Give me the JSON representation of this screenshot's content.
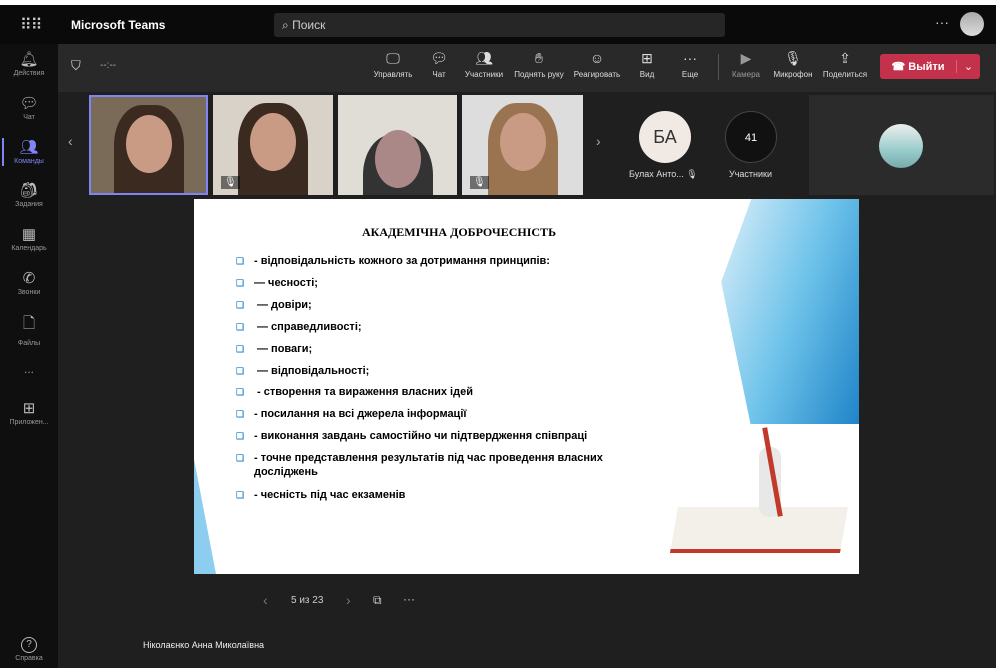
{
  "app": {
    "title": "Microsoft Teams",
    "search_placeholder": "Поиск"
  },
  "rail": [
    {
      "label": "Действия",
      "icon": "bell-icon"
    },
    {
      "label": "Чат",
      "icon": "chat-icon"
    },
    {
      "label": "Команды",
      "icon": "teams-icon"
    },
    {
      "label": "Задания",
      "icon": "backpack-icon"
    },
    {
      "label": "Календарь",
      "icon": "calendar-icon"
    },
    {
      "label": "Звонки",
      "icon": "phone-icon"
    },
    {
      "label": "Файлы",
      "icon": "file-icon"
    },
    {
      "label": "...",
      "icon": "more-icon"
    },
    {
      "label": "Приложен...",
      "icon": "apps-icon"
    }
  ],
  "help": "Справка",
  "meeting": {
    "timer": "--:--",
    "buttons": [
      "Управлять",
      "Чат",
      "Участники",
      "Поднять руку",
      "Реагировать",
      "Вид",
      "Еще",
      "Камера",
      "Микрофон",
      "Поделиться"
    ],
    "leave": "Выйти"
  },
  "participants": {
    "avatar_initials": "БА",
    "avatar_name": "Булах Анто...",
    "count": "41",
    "count_label": "Участники"
  },
  "slide": {
    "title": "АКАДЕМІЧНА ДОБРОЧЕСНІСТЬ",
    "bullets": [
      "- відповідальність кожного за дотримання принципів:",
      "— чесності;",
      "— довіри;",
      "— справедливості;",
      "— поваги;",
      "— відповідальності;",
      "- створення та вираження власних ідей",
      "- посилання на всі джерела інформації",
      "- виконання завдань самостійно чи підтвердження співпраці",
      "- точне представлення результатів під час проведення власних досліджень",
      "- чесність під час екзаменів"
    ]
  },
  "slide_nav": {
    "page": "5 из 23"
  },
  "presenter": "Ніколаєнко Анна Миколаївна",
  "colors": {
    "accent": "#7f85f5",
    "leave": "#c4314b"
  }
}
